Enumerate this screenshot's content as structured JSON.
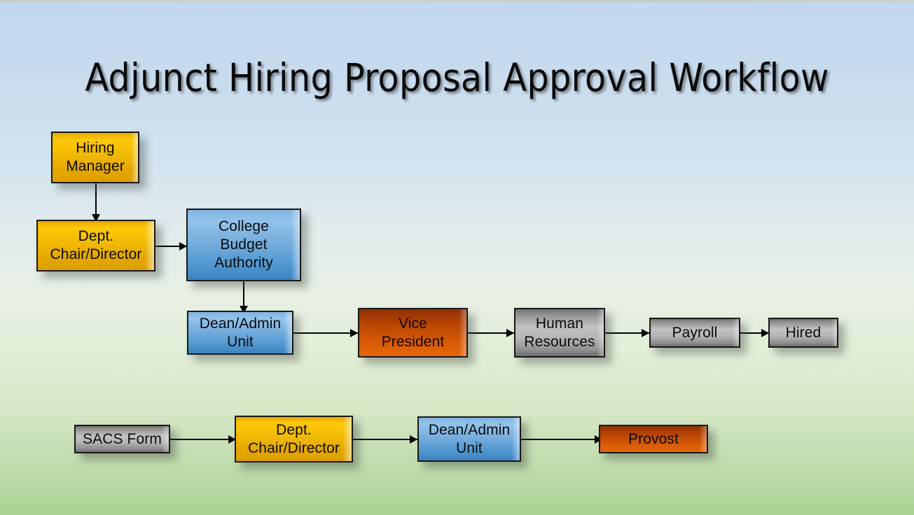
{
  "slide": {
    "title": "Adjunct Hiring Proposal Approval Workflow",
    "background": {
      "top_color": "#c2d8ee",
      "bottom_color": "#a9d193"
    }
  },
  "palette": {
    "gold": "#f2bb03",
    "blue": "#6aa8db",
    "orange": "#c44d04",
    "gray": "#b5b5b5",
    "border": "#181818",
    "connector": "#000000"
  },
  "nodes": [
    {
      "id": "hiring-manager",
      "label": "Hiring Manager",
      "color": "gold",
      "row": "top"
    },
    {
      "id": "dept-chair-director-1",
      "label": "Dept. Chair/Director",
      "color": "gold",
      "row": "top"
    },
    {
      "id": "college-budget",
      "label": "College Budget Authority",
      "color": "blue",
      "row": "top"
    },
    {
      "id": "dean-admin-unit-1",
      "label": "Dean/Admin Unit",
      "color": "blue",
      "row": "middle"
    },
    {
      "id": "vice-president",
      "label": "Vice President",
      "color": "orange",
      "row": "middle"
    },
    {
      "id": "human-resources",
      "label": "Human Resources",
      "color": "gray",
      "row": "middle"
    },
    {
      "id": "payroll",
      "label": "Payroll",
      "color": "gray",
      "row": "middle"
    },
    {
      "id": "hired",
      "label": "Hired",
      "color": "gray",
      "row": "middle"
    },
    {
      "id": "sacs-form",
      "label": "SACS Form",
      "color": "gray",
      "row": "bottom"
    },
    {
      "id": "dept-chair-director-2",
      "label": "Dept. Chair/Director",
      "color": "gold",
      "row": "bottom"
    },
    {
      "id": "dean-admin-unit-2",
      "label": "Dean/Admin Unit",
      "color": "blue",
      "row": "bottom"
    },
    {
      "id": "provost",
      "label": "Provost",
      "color": "orange",
      "row": "bottom"
    }
  ],
  "labels": {
    "hiring_manager_line1": "Hiring",
    "hiring_manager_line2": "Manager",
    "dept_chair_line1": "Dept.",
    "dept_chair_line2": "Chair/Director",
    "college_budget_line1": "College",
    "college_budget_line2": "Budget",
    "college_budget_line3": "Authority",
    "dean_admin_line1": "Dean/Admin",
    "dean_admin_line2": "Unit",
    "vice_president_line1": "Vice",
    "vice_president_line2": "President",
    "human_resources_line1": "Human",
    "human_resources_line2": "Resources",
    "payroll": "Payroll",
    "hired": "Hired",
    "sacs_form": "SACS Form",
    "dept_chair2_line1": "Dept.",
    "dept_chair2_line2": "Chair/Director",
    "dean_admin2_line1": "Dean/Admin",
    "dean_admin2_line2": "Unit",
    "provost": "Provost"
  },
  "connections": [
    {
      "from": "hiring-manager",
      "to": "dept-chair-director-1",
      "direction": "down"
    },
    {
      "from": "dept-chair-director-1",
      "to": "college-budget",
      "direction": "right"
    },
    {
      "from": "college-budget",
      "to": "dean-admin-unit-1",
      "direction": "down"
    },
    {
      "from": "dean-admin-unit-1",
      "to": "vice-president",
      "direction": "right"
    },
    {
      "from": "vice-president",
      "to": "human-resources",
      "direction": "right"
    },
    {
      "from": "human-resources",
      "to": "payroll",
      "direction": "right"
    },
    {
      "from": "payroll",
      "to": "hired",
      "direction": "right"
    },
    {
      "from": "sacs-form",
      "to": "dept-chair-director-2",
      "direction": "right"
    },
    {
      "from": "dept-chair-director-2",
      "to": "dean-admin-unit-2",
      "direction": "right"
    },
    {
      "from": "dean-admin-unit-2",
      "to": "provost",
      "direction": "right"
    }
  ]
}
